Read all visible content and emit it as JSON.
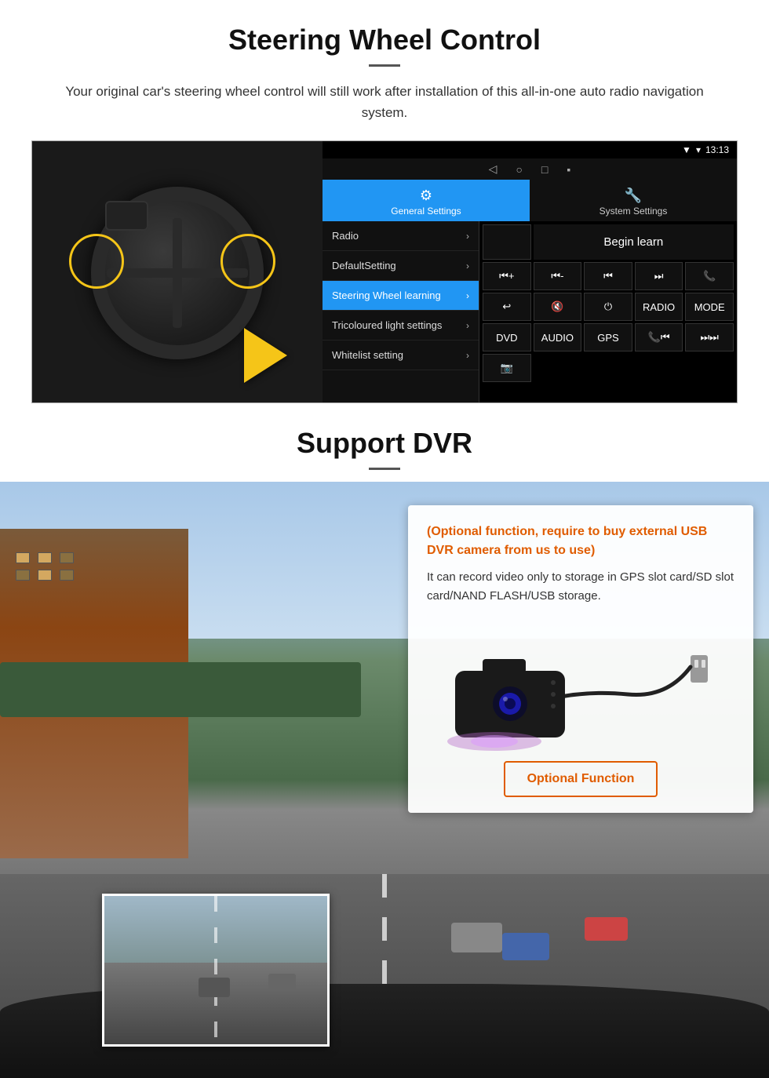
{
  "steering_section": {
    "title": "Steering Wheel Control",
    "subtitle": "Your original car's steering wheel control will still work after installation of this all-in-one auto radio navigation system.",
    "android_statusbar": {
      "signal": "▼",
      "wifi": "▾",
      "time": "13:13"
    },
    "tabs": {
      "general": {
        "label": "General Settings",
        "icon": "⚙"
      },
      "system": {
        "label": "System Settings",
        "icon": "🔧"
      }
    },
    "menu_items": [
      {
        "label": "Radio",
        "active": false
      },
      {
        "label": "DefaultSetting",
        "active": false
      },
      {
        "label": "Steering Wheel learning",
        "active": true
      },
      {
        "label": "Tricoloured light settings",
        "active": false
      },
      {
        "label": "Whitelist setting",
        "active": false
      }
    ],
    "begin_learn_label": "Begin learn",
    "control_buttons": [
      "⏮+",
      "⏮-",
      "⏮⏮",
      "⏭⏭",
      "📞",
      "↩",
      "🔇×",
      "⏻",
      "RADIO",
      "MODE",
      "DVD",
      "AUDIO",
      "GPS",
      "📞⏮",
      "⏭⏭"
    ]
  },
  "dvr_section": {
    "title": "Support DVR",
    "optional_note": "(Optional function, require to buy external USB DVR camera from us to use)",
    "desc": "It can record video only to storage in GPS slot card/SD slot card/NAND FLASH/USB storage.",
    "optional_btn_label": "Optional Function"
  }
}
